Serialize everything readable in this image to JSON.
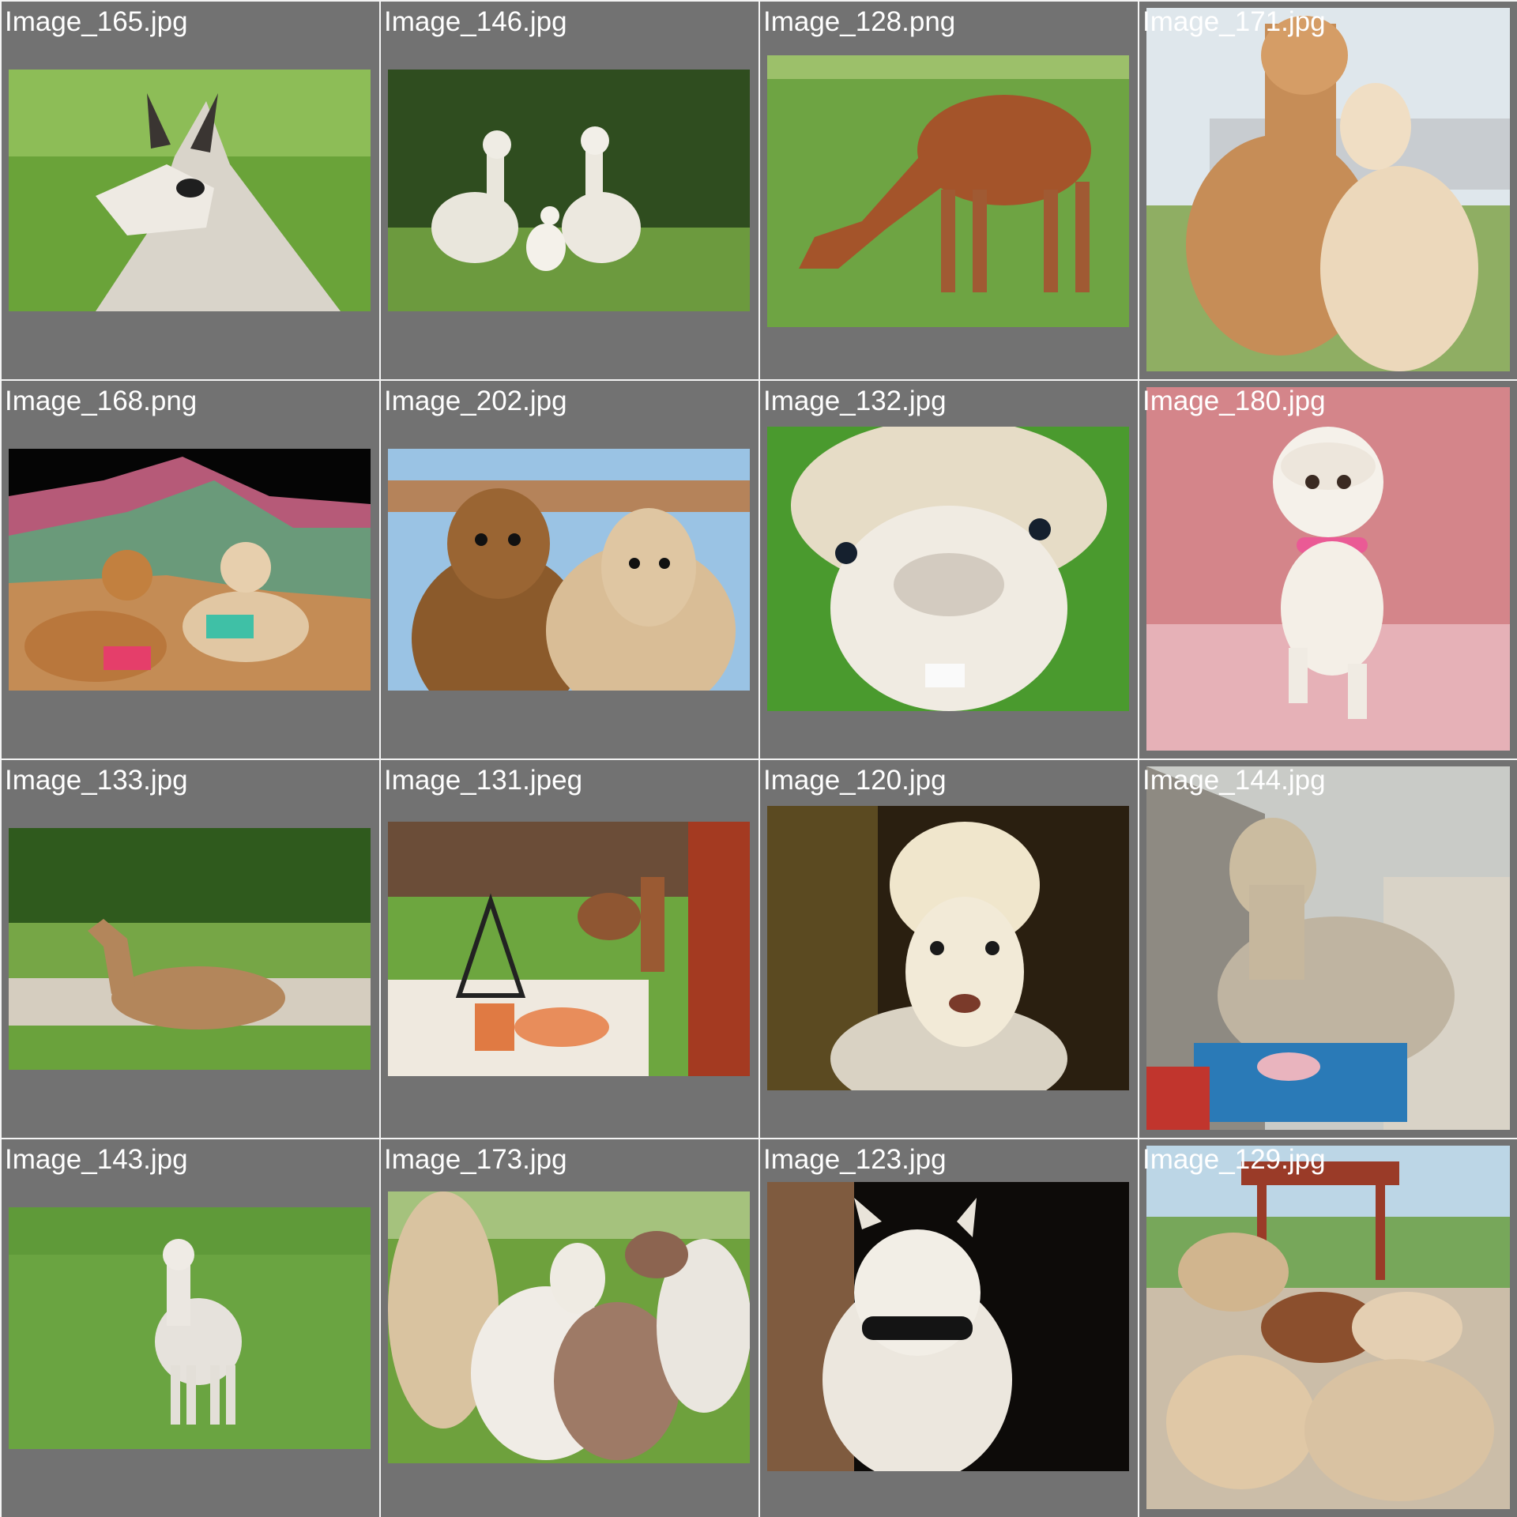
{
  "gallery": {
    "tiles": [
      {
        "filename": "Image_165.jpg",
        "icon": "llama-photo"
      },
      {
        "filename": "Image_146.jpg",
        "icon": "alpaca-photo"
      },
      {
        "filename": "Image_128.png",
        "icon": "alpaca-photo"
      },
      {
        "filename": "Image_171.jpg",
        "icon": "alpaca-photo"
      },
      {
        "filename": "Image_168.png",
        "icon": "alpaca-photo"
      },
      {
        "filename": "Image_202.jpg",
        "icon": "alpaca-photo"
      },
      {
        "filename": "Image_132.jpg",
        "icon": "alpaca-photo"
      },
      {
        "filename": "Image_180.jpg",
        "icon": "alpaca-illustration"
      },
      {
        "filename": "Image_133.jpg",
        "icon": "vicuna-photo"
      },
      {
        "filename": "Image_131.jpeg",
        "icon": "alpaca-photo"
      },
      {
        "filename": "Image_120.jpg",
        "icon": "alpaca-photo"
      },
      {
        "filename": "Image_144.jpg",
        "icon": "alpaca-photo"
      },
      {
        "filename": "Image_143.jpg",
        "icon": "alpaca-photo"
      },
      {
        "filename": "Image_173.jpg",
        "icon": "alpaca-photo"
      },
      {
        "filename": "Image_123.jpg",
        "icon": "alpaca-photo"
      },
      {
        "filename": "Image_129.jpg",
        "icon": "alpaca-photo"
      }
    ]
  },
  "colors": {
    "tile_background": "#727272",
    "grid_gap": "#f4f4f4",
    "label_text": "#ffffff"
  }
}
